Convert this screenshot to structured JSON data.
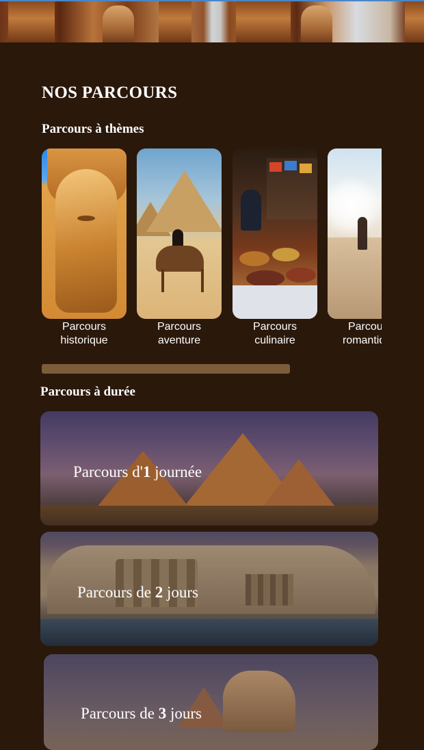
{
  "page": {
    "title": "NOS PARCOURS"
  },
  "themes": {
    "title": "Parcours à thèmes",
    "items": [
      {
        "label_line1": "Parcours",
        "label_line2": "historique",
        "image": "abu-simbel-ramses-statue"
      },
      {
        "label_line1": "Parcours",
        "label_line2": "aventure",
        "image": "pyramids-camel-rider"
      },
      {
        "label_line1": "Parcours",
        "label_line2": "culinaire",
        "image": "spice-market-stall"
      },
      {
        "label_line1": "Parcours",
        "label_line2": "romantique",
        "image": "desert-dune-silhouette"
      }
    ]
  },
  "duree": {
    "title": "Parcours à durée",
    "items": [
      {
        "prefix": "Parcours d'",
        "number": "1",
        "suffix": " journée",
        "image": "giza-pyramids-dusk"
      },
      {
        "prefix": "Parcours de ",
        "number": "2",
        "suffix": " jours",
        "image": "abu-simbel-temple-lake"
      },
      {
        "prefix": "Parcours de ",
        "number": "3",
        "suffix": " jours",
        "image": "sphinx-pyramid"
      }
    ]
  },
  "colors": {
    "background": "#2a180b",
    "scrollbar": "#7c5c3a",
    "text": "#ffffff"
  }
}
